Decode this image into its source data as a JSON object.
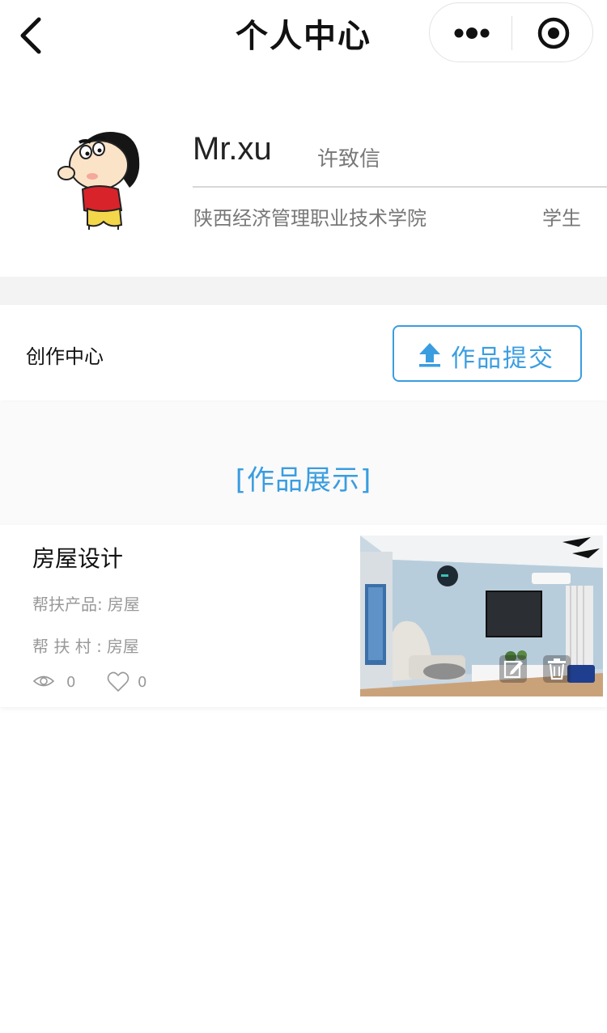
{
  "nav": {
    "title": "个人中心",
    "back_icon": "chevron-left-icon",
    "more_icon": "more-dots-icon",
    "close_icon": "target-circle-icon"
  },
  "profile": {
    "avatar_icon": "cartoon-boy-avatar",
    "nickname": "Mr.xu",
    "real_name": "许致信",
    "school": "陕西经济管理职业技术学院",
    "role": "学生"
  },
  "creation": {
    "label": "创作中心",
    "submit_label": "作品提交",
    "submit_icon": "upload-arrow-icon"
  },
  "works": {
    "section_title": "[作品展示]",
    "items": [
      {
        "title": "房屋设计",
        "product_label": "帮扶产品:",
        "product_value": "房屋",
        "village_label": "帮 扶 村 :",
        "village_value": "房屋",
        "views": "0",
        "likes": "0"
      }
    ]
  },
  "colors": {
    "accent": "#3a9de0",
    "muted_text": "#999999",
    "separator": "#f3f3f3"
  }
}
